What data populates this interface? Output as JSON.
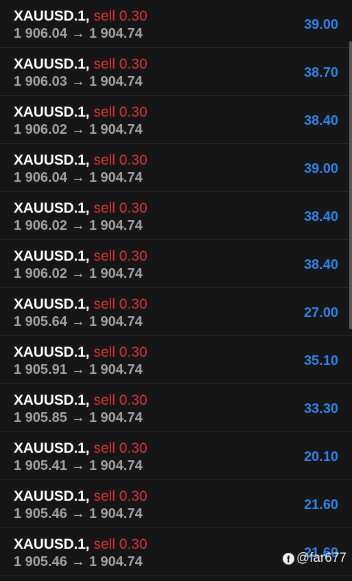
{
  "positions": [
    {
      "symbol": "XAUUSD.1",
      "side": "sell 0.30",
      "open_price": "1 906.04",
      "current_price": "1 904.74",
      "profit": "39.00"
    },
    {
      "symbol": "XAUUSD.1",
      "side": "sell 0.30",
      "open_price": "1 906.03",
      "current_price": "1 904.74",
      "profit": "38.70"
    },
    {
      "symbol": "XAUUSD.1",
      "side": "sell 0.30",
      "open_price": "1 906.02",
      "current_price": "1 904.74",
      "profit": "38.40"
    },
    {
      "symbol": "XAUUSD.1",
      "side": "sell 0.30",
      "open_price": "1 906.04",
      "current_price": "1 904.74",
      "profit": "39.00"
    },
    {
      "symbol": "XAUUSD.1",
      "side": "sell 0.30",
      "open_price": "1 906.02",
      "current_price": "1 904.74",
      "profit": "38.40"
    },
    {
      "symbol": "XAUUSD.1",
      "side": "sell 0.30",
      "open_price": "1 906.02",
      "current_price": "1 904.74",
      "profit": "38.40"
    },
    {
      "symbol": "XAUUSD.1",
      "side": "sell 0.30",
      "open_price": "1 905.64",
      "current_price": "1 904.74",
      "profit": "27.00"
    },
    {
      "symbol": "XAUUSD.1",
      "side": "sell 0.30",
      "open_price": "1 905.91",
      "current_price": "1 904.74",
      "profit": "35.10"
    },
    {
      "symbol": "XAUUSD.1",
      "side": "sell 0.30",
      "open_price": "1 905.85",
      "current_price": "1 904.74",
      "profit": "33.30"
    },
    {
      "symbol": "XAUUSD.1",
      "side": "sell 0.30",
      "open_price": "1 905.41",
      "current_price": "1 904.74",
      "profit": "20.10"
    },
    {
      "symbol": "XAUUSD.1",
      "side": "sell 0.30",
      "open_price": "1 905.46",
      "current_price": "1 904.74",
      "profit": "21.60"
    },
    {
      "symbol": "XAUUSD.1",
      "side": "sell 0.30",
      "open_price": "1 905.46",
      "current_price": "1 904.74",
      "profit": "21.60"
    }
  ],
  "separator": ",",
  "arrow": "→",
  "watermark": {
    "icon": "facebook-icon",
    "text": "@far677"
  },
  "colors": {
    "background": "#161616",
    "symbol": "#ffffff",
    "sell": "#e03131",
    "prices": "#a3a3a3",
    "profit": "#2f84e6"
  }
}
